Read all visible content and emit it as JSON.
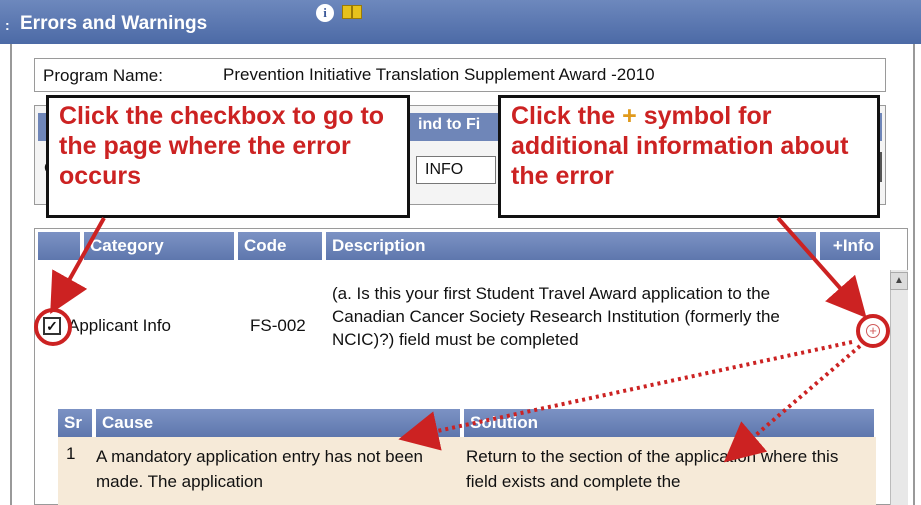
{
  "header": {
    "title": "Errors and Warnings",
    "title_arrow": ":",
    "info_glyph": "i"
  },
  "program": {
    "label": "Program Name:",
    "value": "Prevention Initiative Translation Supplement Award -2010"
  },
  "filter": {
    "partial_label": "ind to Fi",
    "select_value": "INFO",
    "partial_button": "d"
  },
  "callouts": {
    "left": "Click the checkbox to go to the page where the error occurs",
    "right_before": "Click the ",
    "right_plus": "+",
    "right_after": " symbol for additional information about the error"
  },
  "errors_table": {
    "columns": [
      "Category",
      "Code",
      "Description",
      "+Info"
    ],
    "row": {
      "checked_glyph": "✓",
      "category": "Applicant Info",
      "code": "FS-002",
      "description": "(a. Is this your first Student Travel Award application to the Canadian Cancer Society Research Institution (formerly the NCIC)?) field must be completed",
      "plus_glyph": "+"
    }
  },
  "cause_table": {
    "columns": [
      "Sr",
      "Cause",
      "Solution"
    ],
    "row": {
      "sr": "1",
      "cause": "A mandatory application entry has not been made. The application",
      "solution": "Return to the section of the application where this field exists and complete the"
    }
  },
  "colors": {
    "header_blue": "#4c6aa6",
    "annotation_red": "#cc2222",
    "plus_orange": "#e09a1d",
    "row_beige": "#f6ead8"
  },
  "icons": [
    "info-icon",
    "book-icon",
    "checkbox-icon",
    "plus-icon",
    "scroll-up-icon"
  ]
}
